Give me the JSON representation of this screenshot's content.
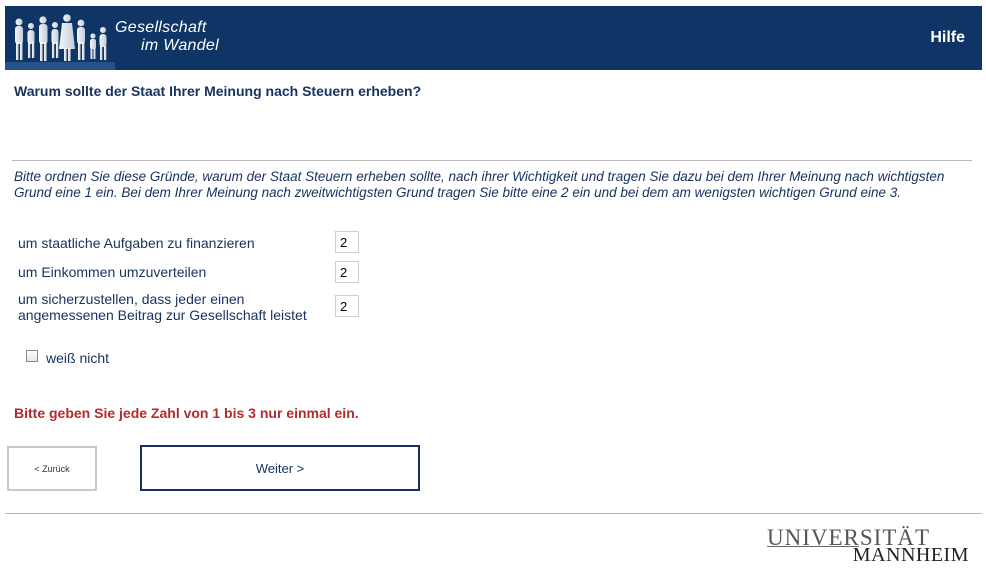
{
  "header": {
    "logo_line1": "Gesellschaft",
    "logo_line2": "im Wandel",
    "help_label": "Hilfe",
    "bg_color": "#0f3567"
  },
  "question": {
    "title": "Warum sollte der Staat Ihrer Meinung nach Steuern erheben?",
    "instructions": "Bitte ordnen Sie diese Gründe, warum der Staat Steuern erheben sollte, nach ihrer Wichtigkeit und tragen Sie dazu bei dem Ihrer Meinung nach wichtigsten Grund eine 1 ein. Bei dem Ihrer Meinung nach zweitwichtigsten Grund tragen Sie bitte eine 2 ein und bei dem am wenigsten wichtigen Grund eine 3."
  },
  "items": [
    {
      "label": "um staatliche Aufgaben zu finanzieren",
      "value": "2"
    },
    {
      "label": "um Einkommen umzuverteilen",
      "value": "2"
    },
    {
      "label_line1": "um sicherzustellen, dass jeder einen",
      "label_line2": "angemessenen Beitrag zur Gesellschaft leistet",
      "value": "2"
    }
  ],
  "dont_know": {
    "label": "weiß nicht",
    "checked": false
  },
  "error": {
    "message": "Bitte geben Sie jede Zahl von 1 bis 3 nur einmal ein.",
    "color": "#b52a2f"
  },
  "nav": {
    "back_label": "< Zurück",
    "next_label": "Weiter >"
  },
  "footer": {
    "uni_line1": "UNIVERSITÄT",
    "uni_line2": "MANNHEIM"
  }
}
